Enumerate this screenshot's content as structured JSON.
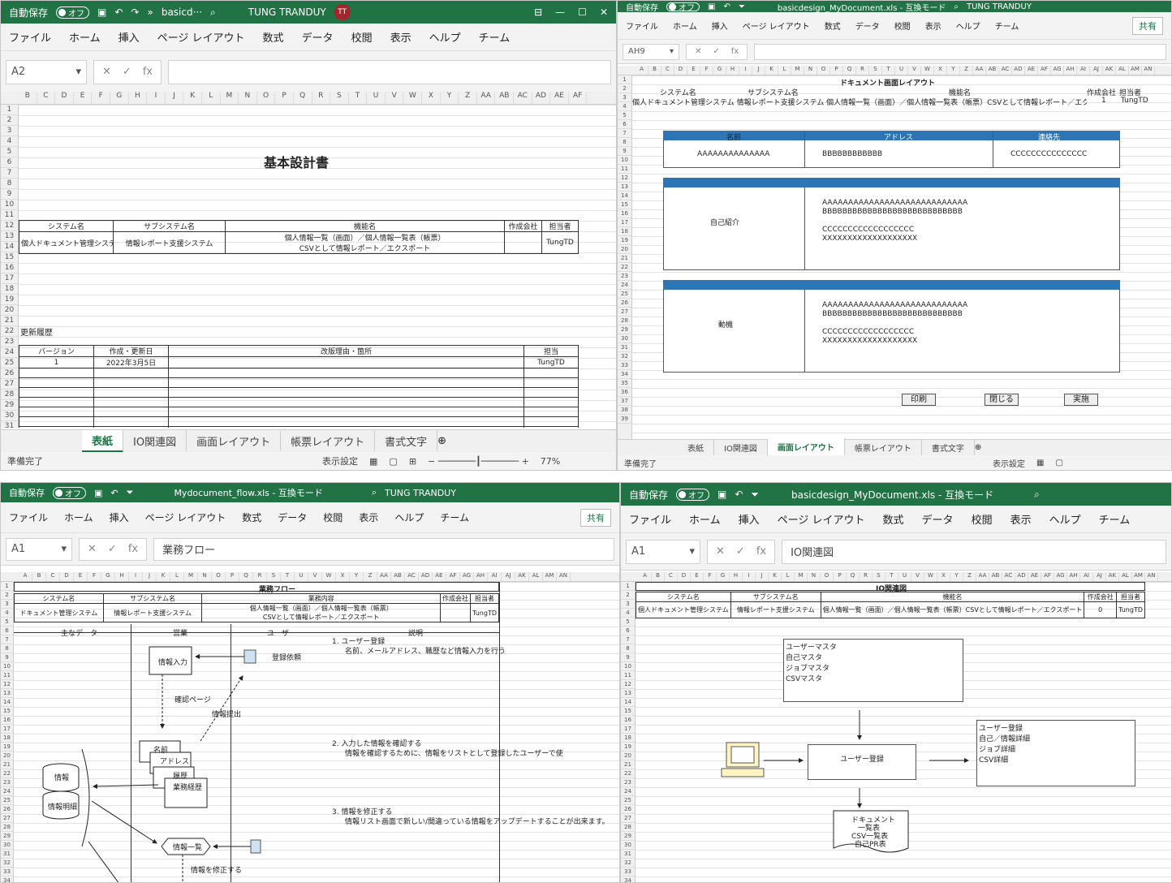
{
  "tl": {
    "autosave": "自動保存",
    "off": "オフ",
    "file": "basicd···",
    "user": "TUNG TRANDUY",
    "initials": "TT",
    "menu": [
      "ファイル",
      "ホーム",
      "挿入",
      "ページ レイアウト",
      "数式",
      "データ",
      "校閲",
      "表示",
      "ヘルプ",
      "チーム"
    ],
    "namebox": "A2",
    "formula": "",
    "cols": [
      "B",
      "C",
      "D",
      "E",
      "F",
      "G",
      "H",
      "I",
      "J",
      "K",
      "L",
      "M",
      "N",
      "O",
      "P",
      "Q",
      "R",
      "S",
      "T",
      "U",
      "V",
      "W",
      "X",
      "Y",
      "Z",
      "AA",
      "AB",
      "AC",
      "AD",
      "AE",
      "AF"
    ],
    "title": "基本設計書",
    "hdr": [
      "システム名",
      "サブシステム名",
      "機能名",
      "作成会社",
      "担当者"
    ],
    "row": [
      "個人ドキュメント管理システム",
      "情報レポート支援システム",
      "個人情報一覧（画面）／個人情報一覧表（帳票）",
      "CSVとして情報レポート／エクスポート",
      "",
      "TungTD"
    ],
    "history": "更新履歴",
    "hhdr": [
      "バージョン",
      "作成・更新日",
      "改版理由・箇所",
      "担当"
    ],
    "hrow": [
      "1",
      "2022年3月5日",
      "",
      "TungTD"
    ],
    "tabs": [
      "表紙",
      "IO関連図",
      "画面レイアウト",
      "帳票レイアウト",
      "書式文字"
    ],
    "status": "準備完了",
    "display": "表示設定",
    "zoom": "77%"
  },
  "tr": {
    "autosave": "自動保存",
    "off": "オフ",
    "file": "basicdesign_MyDocument.xls - 互換モード",
    "user": "TUNG TRANDUY",
    "share": "共有",
    "menu": [
      "ファイル",
      "ホーム",
      "挿入",
      "ページ レイアウト",
      "数式",
      "データ",
      "校閲",
      "表示",
      "ヘルプ",
      "チーム"
    ],
    "namebox": "AH9",
    "formula": "",
    "title": "ドキュメント画面レイアウト",
    "hdr": [
      "システム名",
      "サブシステム名",
      "機能名",
      "作成会社",
      "担当者"
    ],
    "row": "個人ドキュメント管理システム 情報レポート支援システム 個人情報一覧（画面）／個人情報一覧表（帳票）CSVとして情報レポート／エクスポート",
    "rowc": [
      "1",
      "TungTD"
    ],
    "fields": [
      "名前",
      "アドレス",
      "連絡先"
    ],
    "vals": [
      "AAAAAAAAAAAAAA",
      "BBBBBBBBBBBB",
      "CCCCCCCCCCCCCCC"
    ],
    "self": "自己紹介",
    "mot": "動機",
    "lines": [
      "AAAAAAAAAAAAAAAAAAAAAAAAAAAA",
      "BBBBBBBBBBBBBBBBBBBBBBBBBBBB",
      "CCCCCCCCCCCCCCCCCC",
      "XXXXXXXXXXXXXXXXXXX"
    ],
    "btns": [
      "印刷",
      "閉じる",
      "実施"
    ],
    "tabs": [
      "表紙",
      "IO関連図",
      "画面レイアウト",
      "帳票レイアウト",
      "書式文字"
    ],
    "status": "準備完了",
    "display": "表示設定"
  },
  "bl": {
    "autosave": "自動保存",
    "off": "オフ",
    "file": "Mydocument_flow.xls - 互換モード",
    "user": "TUNG TRANDUY",
    "share": "共有",
    "menu": [
      "ファイル",
      "ホーム",
      "挿入",
      "ページ レイアウト",
      "数式",
      "データ",
      "校閲",
      "表示",
      "ヘルプ",
      "チーム"
    ],
    "namebox": "A1",
    "formula": "業務フロー",
    "title": "業務フロー",
    "hdr": [
      "システム名",
      "サブシステム名",
      "業務内容",
      "作成会社",
      "担当者"
    ],
    "row": [
      "ドキュメント管理システム",
      "情報レポート支援システム",
      "個人情報一覧（画面）／個人情報一覧表（帳票）",
      "CSVとして情報レポート／エクスポート",
      "TungTD"
    ],
    "lanes": [
      "主なデータ",
      "営業",
      "ユーザー",
      "説明"
    ],
    "nodes": [
      "情報入力",
      "登録依頼",
      "確認ページ",
      "情報提出",
      "名前",
      "アドレス",
      "履歴",
      "業務経歴",
      "情報",
      "情報明細",
      "情報一覧",
      "情報を修正する"
    ],
    "desc": [
      "1. ユーザー登録",
      "名前、メールアドレス、職歴など情報入力を行う",
      "2. 入力した情報を確認する",
      "情報を確認するために、情報をリストとして登録したユーザーで使",
      "3. 情報を修正する",
      "情報リスト画面で新しい/間違っている情報をアップデートすることが出来ます。"
    ]
  },
  "br": {
    "autosave": "自動保存",
    "off": "オフ",
    "file": "basicdesign_MyDocument.xls - 互換モード",
    "menu": [
      "ファイル",
      "ホーム",
      "挿入",
      "ページ レイアウト",
      "数式",
      "データ",
      "校閲",
      "表示",
      "ヘルプ",
      "チーム"
    ],
    "namebox": "A1",
    "formula": "IO関連図",
    "title": "IO関連図",
    "hdr": [
      "システム名",
      "サブシステム名",
      "機能名",
      "作成会社",
      "担当者"
    ],
    "row": [
      "個人ドキュメント管理システム",
      "情報レポート支援システム",
      "個人情報一覧（画面）／個人情報一覧表（帳票）CSVとして情報レポート／エクスポート",
      "0",
      "TungTD"
    ],
    "masters": [
      "ユーザーマスタ",
      "自己マスタ",
      "ジョブマスタ",
      "CSVマスタ"
    ],
    "center": "ユーザー登録",
    "outs": [
      "ユーザー登録",
      "自己／情報詳細",
      "ジョブ詳細",
      "CSV詳細"
    ],
    "docs": [
      "ドキュメント",
      "一覧表",
      "CSV一覧表",
      "自己PR表"
    ]
  }
}
